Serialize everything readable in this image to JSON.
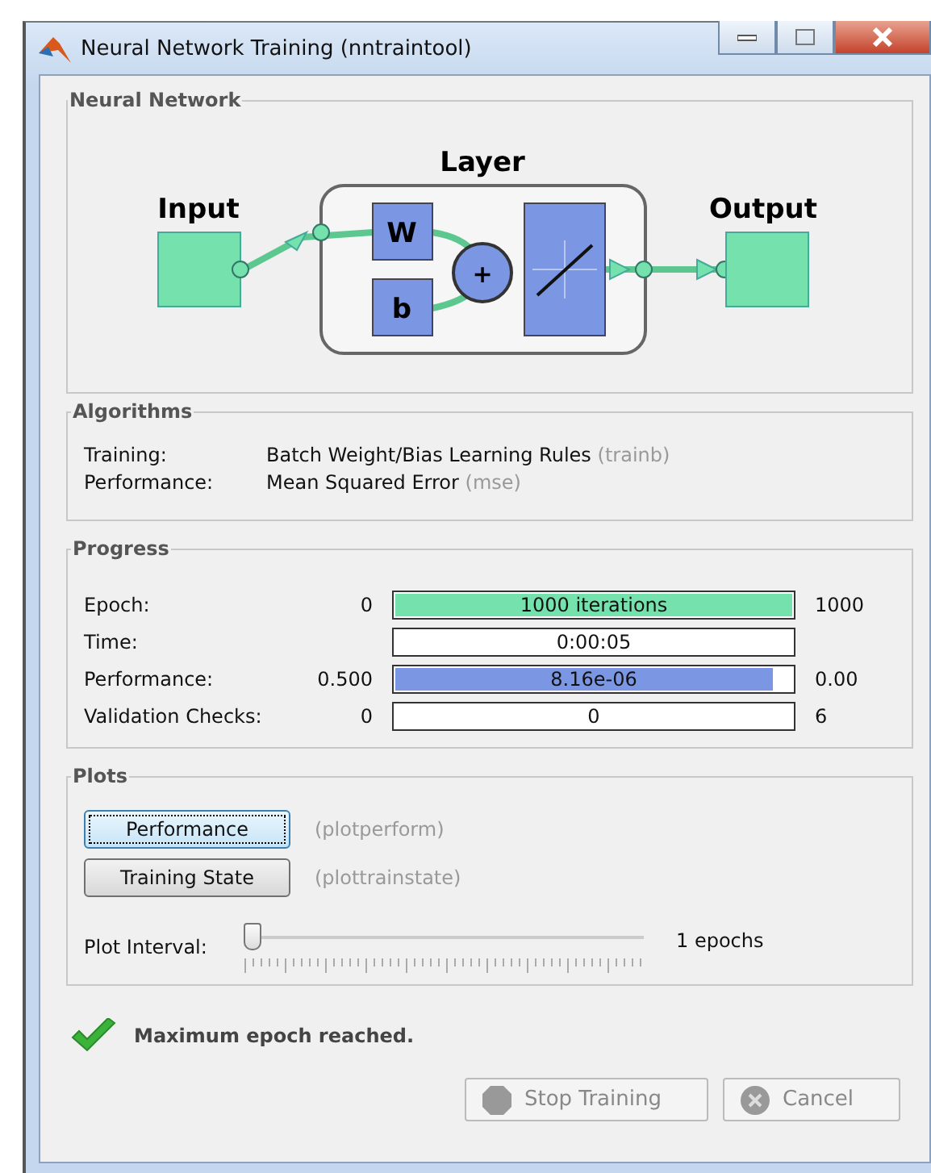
{
  "window": {
    "title": "Neural Network Training (nntraintool)"
  },
  "neural_network": {
    "title": "Neural Network",
    "input_label": "Input",
    "layer_label": "Layer",
    "output_label": "Output",
    "weight": "W",
    "bias": "b",
    "sum": "+"
  },
  "algorithms": {
    "title": "Algorithms",
    "rows": [
      {
        "label": "Training:",
        "value": "Batch Weight/Bias Learning Rules",
        "function": "(trainb)"
      },
      {
        "label": "Performance:",
        "value": "Mean Squared Error",
        "function": "(mse)"
      }
    ]
  },
  "progress": {
    "title": "Progress",
    "rows": [
      {
        "kind": "meter",
        "label": "Epoch:",
        "min": "0",
        "text": "1000 iterations",
        "max": "1000",
        "level": 1,
        "color": "#75e1ad"
      },
      {
        "kind": "readout",
        "label": "Time:",
        "text": "0:00:05"
      },
      {
        "kind": "meter",
        "label": "Performance:",
        "min": "0.500",
        "text": "8.16e-06",
        "max": "0.00",
        "level": 0.95,
        "color": "#7b96e2"
      },
      {
        "kind": "readout",
        "label": "Validation Checks:",
        "min": "0",
        "text": "0",
        "max": "6"
      }
    ]
  },
  "plots": {
    "title": "Plots",
    "buttons": [
      {
        "label": "Performance",
        "hint": "(plotperform)",
        "focused": true
      },
      {
        "label": "Training State",
        "hint": "(plottrainstate)",
        "focused": false
      }
    ],
    "interval": {
      "label": "Plot Interval:",
      "level": 0,
      "value": "1 epochs"
    }
  },
  "status": {
    "message": "Maximum epoch reached."
  },
  "buttons": [
    {
      "kind": "stop",
      "label": "Stop Training",
      "disabled": true
    },
    {
      "kind": "cancel",
      "label": "Cancel",
      "disabled": true
    }
  ]
}
